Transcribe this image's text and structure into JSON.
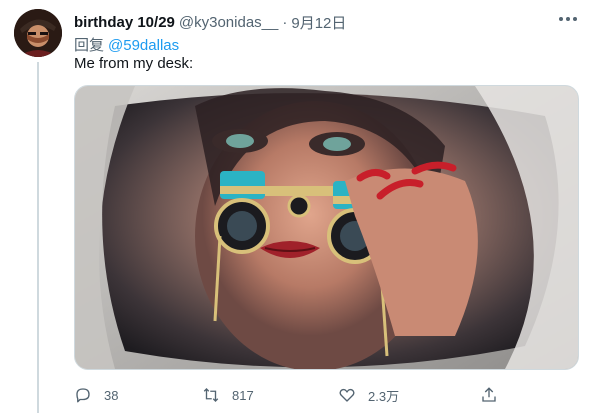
{
  "tweet": {
    "display_name": "birthday 10/29",
    "handle": "@ky3onidas__",
    "separator": "·",
    "date": "9月12日",
    "reply_prefix": "回复",
    "reply_to": "@59dallas",
    "text": "Me from my desk:",
    "more_icon": "more-horizontal-icon",
    "media_description_icon": "photo"
  },
  "actions": {
    "reply_count": "38",
    "retweet_count": "817",
    "like_count": "2.3万",
    "reply_icon": "reply-icon",
    "retweet_icon": "retweet-icon",
    "like_icon": "heart-icon",
    "share_icon": "share-icon"
  },
  "colors": {
    "accent": "#1d9bf0",
    "secondary_text": "#536471",
    "primary_text": "#0f1419",
    "border": "#cfd9de"
  }
}
